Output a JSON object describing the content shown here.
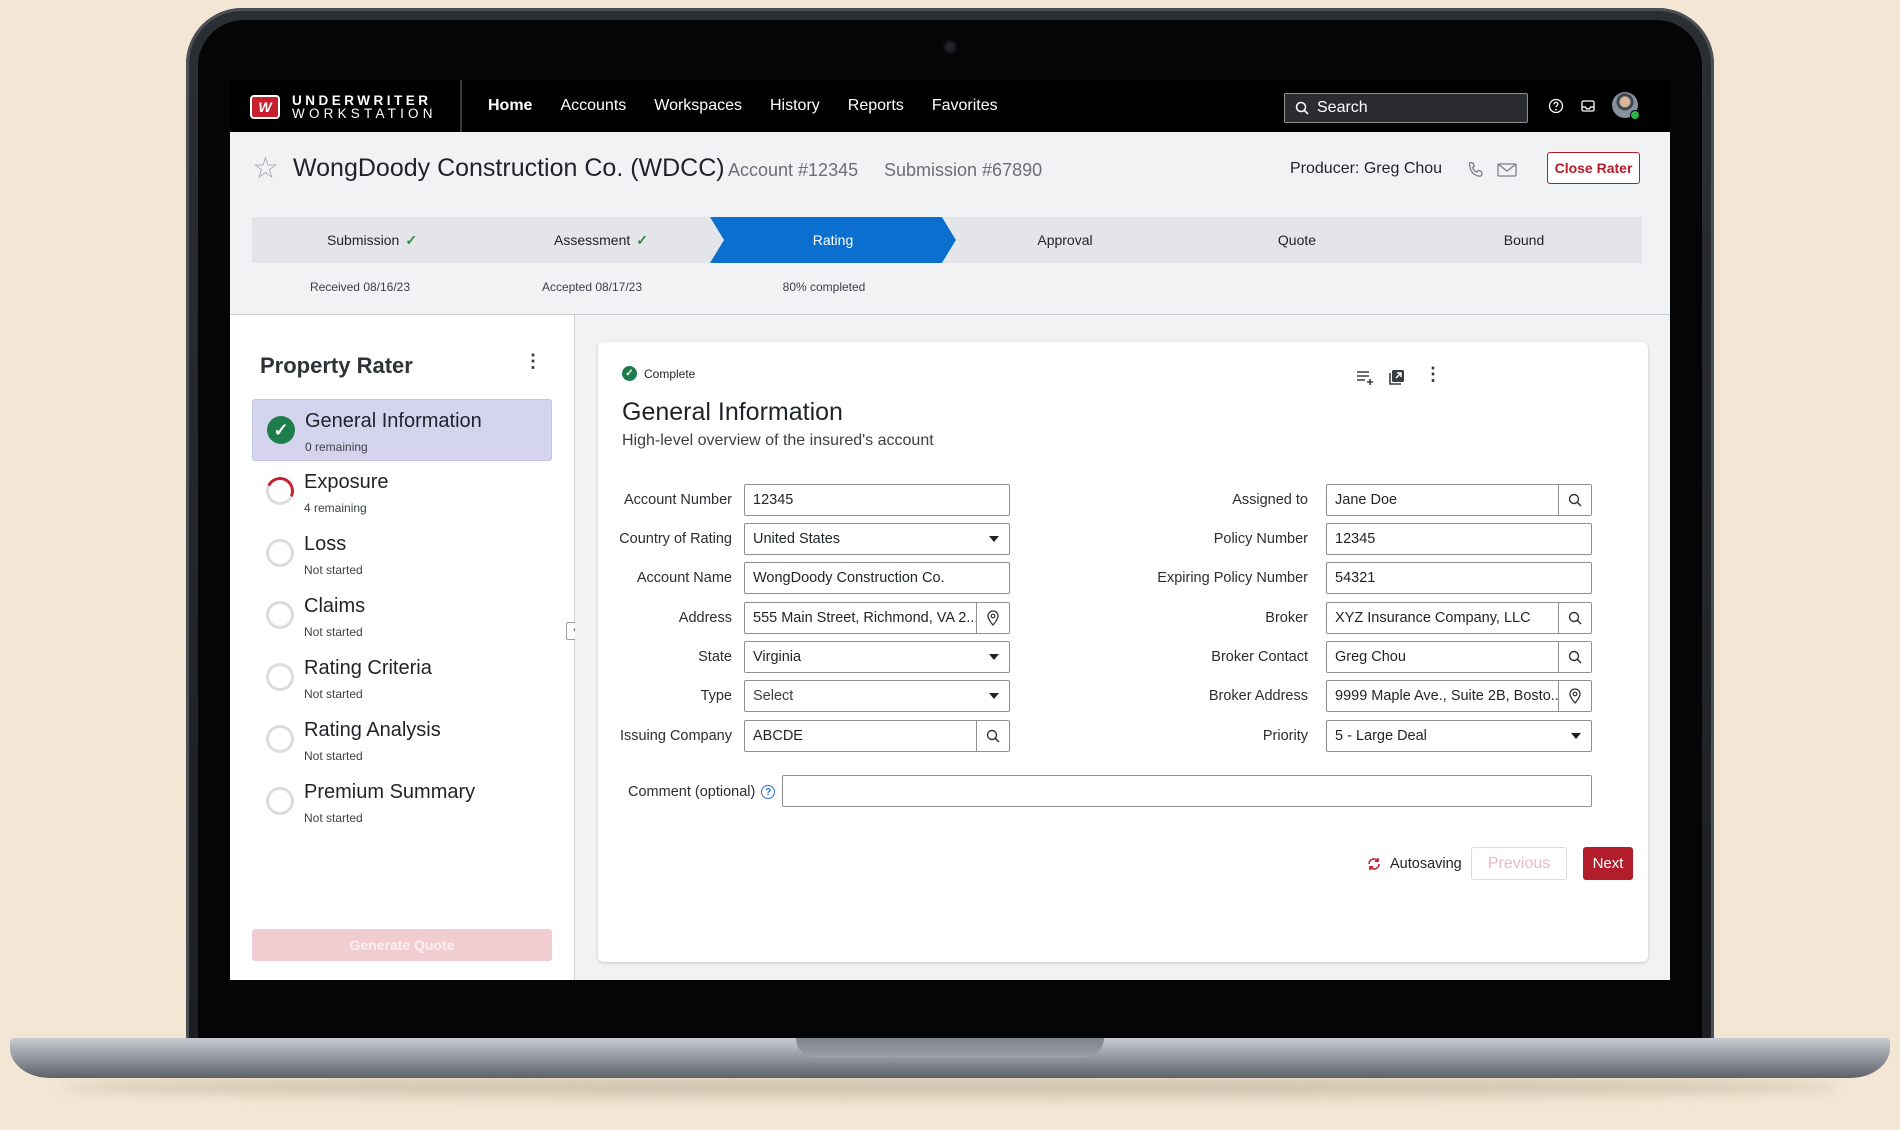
{
  "app": {
    "logo_mark": "W",
    "logo_line1": "UNDERWRITER",
    "logo_line2": "WORKSTATION"
  },
  "nav": [
    "Home",
    "Accounts",
    "Workspaces",
    "History",
    "Reports",
    "Favorites"
  ],
  "search": {
    "placeholder": "Search"
  },
  "header": {
    "title": "WongDoody Construction Co. (WDCC)",
    "account_number": "Account #12345",
    "submission_number": "Submission #67890",
    "producer": "Producer: Greg Chou",
    "close_button": "Close Rater"
  },
  "stepper": {
    "steps": [
      {
        "label": "Submission",
        "state": "done",
        "caption": "Received 08/16/23"
      },
      {
        "label": "Assessment",
        "state": "done",
        "caption": "Accepted 08/17/23"
      },
      {
        "label": "Rating",
        "state": "active",
        "caption": "80% completed"
      },
      {
        "label": "Approval",
        "state": "pending",
        "caption": ""
      },
      {
        "label": "Quote",
        "state": "pending",
        "caption": ""
      },
      {
        "label": "Bound",
        "state": "pending",
        "caption": ""
      }
    ]
  },
  "sidebar": {
    "title": "Property Rater",
    "items": [
      {
        "label": "General Information",
        "status": "0 remaining",
        "state": "done"
      },
      {
        "label": "Exposure",
        "status": "4 remaining",
        "state": "partial"
      },
      {
        "label": "Loss",
        "status": "Not started",
        "state": "empty"
      },
      {
        "label": "Claims",
        "status": "Not started",
        "state": "empty"
      },
      {
        "label": "Rating Criteria",
        "status": "Not started",
        "state": "empty"
      },
      {
        "label": "Rating Analysis",
        "status": "Not started",
        "state": "empty"
      },
      {
        "label": "Premium Summary",
        "status": "Not started",
        "state": "empty"
      }
    ],
    "generate_button": "Generate Quote"
  },
  "form": {
    "badge": "Complete",
    "title": "General Information",
    "subtitle": "High-level overview of the insured's account",
    "left": [
      {
        "label": "Account Number",
        "value": "12345",
        "kind": "text"
      },
      {
        "label": "Country of Rating",
        "value": "United States",
        "kind": "select"
      },
      {
        "label": "Account Name",
        "value": "WongDoody Construction Co.",
        "kind": "text"
      },
      {
        "label": "Address",
        "value": "555 Main Street, Richmond, VA 2...",
        "kind": "location"
      },
      {
        "label": "State",
        "value": "Virginia",
        "kind": "select"
      },
      {
        "label": "Type",
        "value": "Select",
        "kind": "select"
      },
      {
        "label": "Issuing Company",
        "value": "ABCDE",
        "kind": "search"
      }
    ],
    "right": [
      {
        "label": "Assigned to",
        "value": "Jane Doe",
        "kind": "search"
      },
      {
        "label": "Policy Number",
        "value": "12345",
        "kind": "text"
      },
      {
        "label": "Expiring Policy Number",
        "value": "54321",
        "kind": "text"
      },
      {
        "label": "Broker",
        "value": "XYZ Insurance Company, LLC",
        "kind": "search"
      },
      {
        "label": "Broker Contact",
        "value": "Greg Chou",
        "kind": "search"
      },
      {
        "label": "Broker Address",
        "value": "9999 Maple Ave., Suite 2B, Bosto...",
        "kind": "location"
      },
      {
        "label": "Priority",
        "value": "5 - Large Deal",
        "kind": "select"
      }
    ],
    "comment_label": "Comment (optional)",
    "comment_value": "",
    "autosave": "Autosaving",
    "previous_button": "Previous",
    "next_button": "Next"
  },
  "colors": {
    "brand_red": "#b31c2a",
    "active_step": "#0b6fcf",
    "success_green": "#1d7e4c",
    "active_nav_item_bg": "#d5d4ef"
  }
}
